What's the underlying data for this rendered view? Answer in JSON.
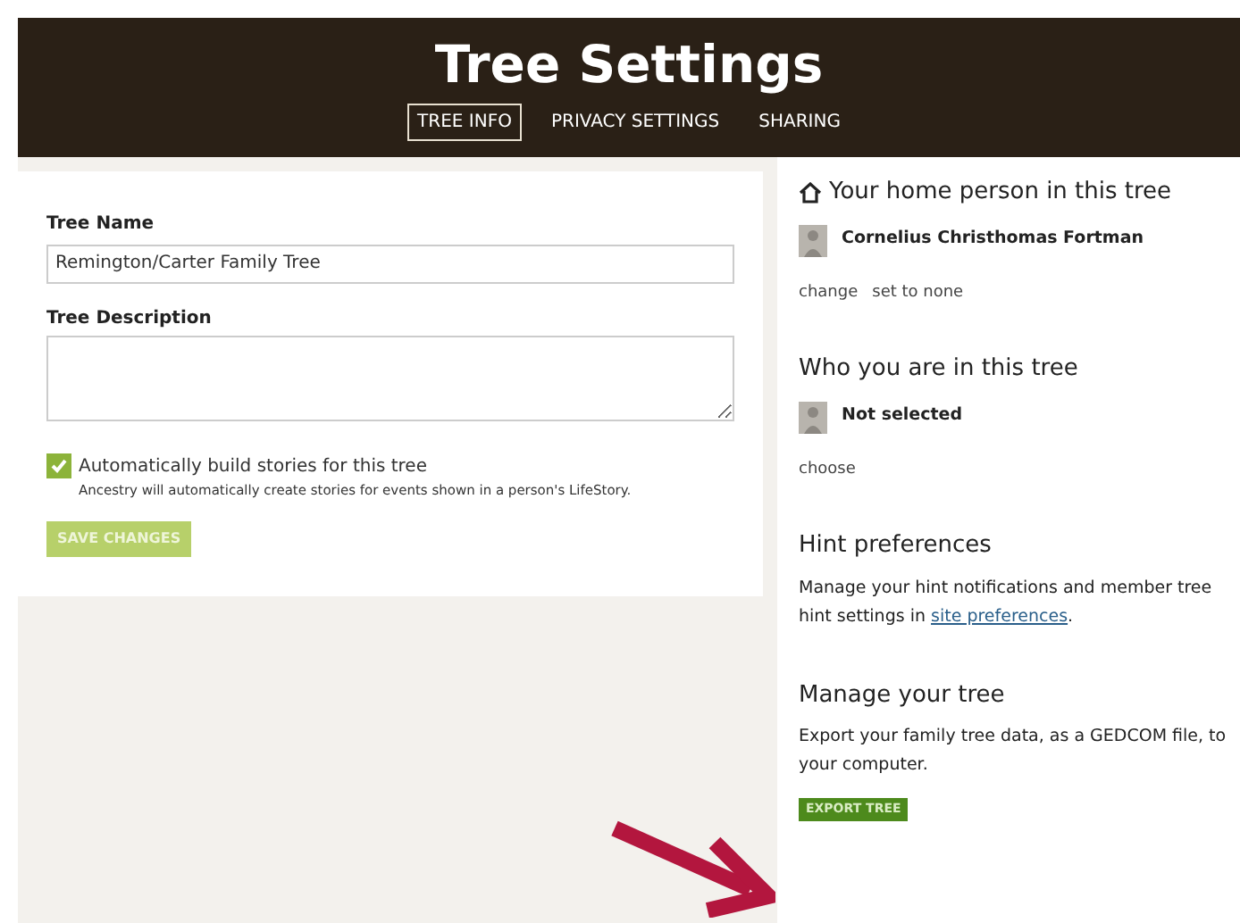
{
  "header": {
    "title": "Tree Settings"
  },
  "tabs": [
    {
      "label": "TREE INFO",
      "selected": true
    },
    {
      "label": "PRIVACY SETTINGS",
      "selected": false
    },
    {
      "label": "SHARING",
      "selected": false
    }
  ],
  "tree_form": {
    "name_label": "Tree Name",
    "name_value": "Remington/Carter Family Tree",
    "description_label": "Tree Description",
    "auto_stories": {
      "label": "Automatically build stories for this tree",
      "hint": "Ancestry will automatically create stories for events shown in a person's LifeStory.",
      "checked": true
    },
    "save_button": "SAVE CHANGES"
  },
  "home_person": {
    "title": "Your home person in this tree",
    "person": "Cornelius Christhomas Fortman",
    "links": [
      "change",
      "set to none"
    ]
  },
  "who_you_are": {
    "title": "Who you are in this tree",
    "person": "Not selected",
    "links": [
      "choose"
    ]
  },
  "hint_preferences": {
    "title": "Hint preferences",
    "text": "Manage your hint notifications and member tree hint settings in ",
    "link": "site preferences",
    "after": "."
  },
  "manage_tree": {
    "title": "Manage your tree",
    "text": "Export your family tree data, as a GEDCOM file, to your computer.",
    "button": "EXPORT TREE"
  }
}
